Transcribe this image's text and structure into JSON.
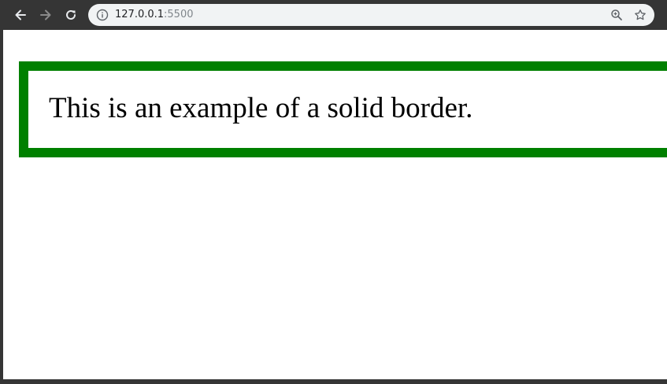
{
  "browser": {
    "url_host": "127.0.0.1",
    "url_port": ":5500",
    "back_icon": "arrow-left-icon",
    "forward_icon": "arrow-right-icon",
    "reload_icon": "reload-icon",
    "info_icon": "info-icon",
    "zoom_icon": "zoom-icon",
    "star_icon": "star-icon"
  },
  "page": {
    "text": "This is an example of a solid border.",
    "border_color": "#008000"
  }
}
